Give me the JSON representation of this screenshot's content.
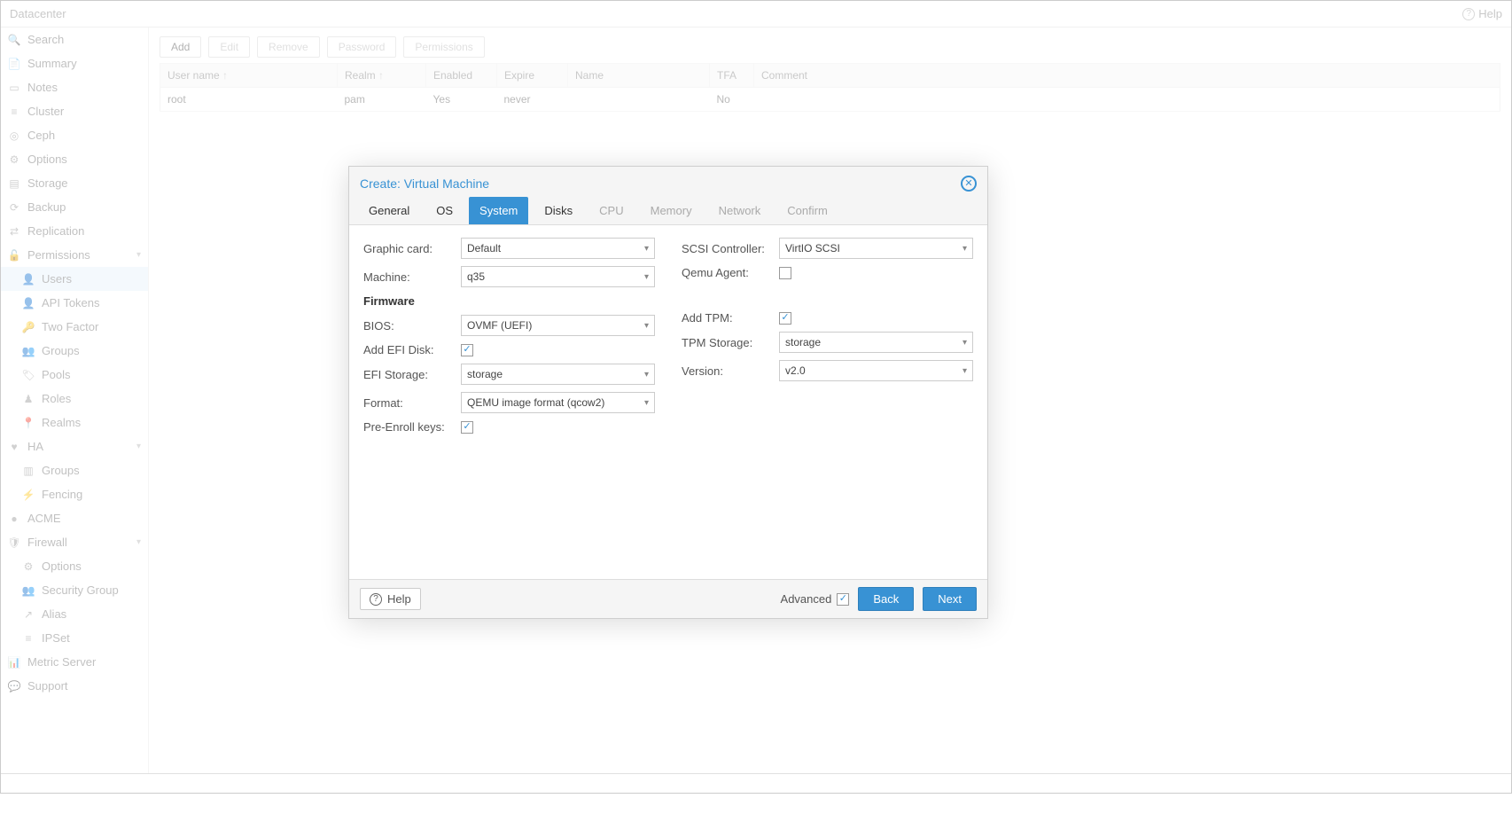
{
  "header": {
    "title": "Datacenter",
    "help": "Help"
  },
  "sidebar": {
    "items": [
      {
        "label": "Search",
        "icon": "🔍"
      },
      {
        "label": "Summary",
        "icon": "📄"
      },
      {
        "label": "Notes",
        "icon": "▭"
      },
      {
        "label": "Cluster",
        "icon": "≡"
      },
      {
        "label": "Ceph",
        "icon": "◎"
      },
      {
        "label": "Options",
        "icon": "⚙"
      },
      {
        "label": "Storage",
        "icon": "▤"
      },
      {
        "label": "Backup",
        "icon": "⟳"
      },
      {
        "label": "Replication",
        "icon": "⇄"
      },
      {
        "label": "Permissions",
        "icon": "🔓",
        "expandable": true
      },
      {
        "label": "Users",
        "icon": "👤",
        "child": true,
        "selected": true
      },
      {
        "label": "API Tokens",
        "icon": "👤",
        "child": true
      },
      {
        "label": "Two Factor",
        "icon": "🔑",
        "child": true
      },
      {
        "label": "Groups",
        "icon": "👥",
        "child": true
      },
      {
        "label": "Pools",
        "icon": "🏷",
        "child": true
      },
      {
        "label": "Roles",
        "icon": "♟",
        "child": true
      },
      {
        "label": "Realms",
        "icon": "📍",
        "child": true
      },
      {
        "label": "HA",
        "icon": "♥",
        "expandable": true
      },
      {
        "label": "Groups",
        "icon": "▥",
        "child": true
      },
      {
        "label": "Fencing",
        "icon": "⚡",
        "child": true
      },
      {
        "label": "ACME",
        "icon": "●"
      },
      {
        "label": "Firewall",
        "icon": "🛡",
        "expandable": true
      },
      {
        "label": "Options",
        "icon": "⚙",
        "child": true
      },
      {
        "label": "Security Group",
        "icon": "👥",
        "child": true
      },
      {
        "label": "Alias",
        "icon": "↗",
        "child": true
      },
      {
        "label": "IPSet",
        "icon": "≡",
        "child": true
      },
      {
        "label": "Metric Server",
        "icon": "📊"
      },
      {
        "label": "Support",
        "icon": "💬"
      }
    ]
  },
  "toolbar": {
    "buttons": [
      {
        "label": "Add",
        "enabled": true
      },
      {
        "label": "Edit",
        "enabled": false
      },
      {
        "label": "Remove",
        "enabled": false
      },
      {
        "label": "Password",
        "enabled": false
      },
      {
        "label": "Permissions",
        "enabled": false
      }
    ]
  },
  "table": {
    "columns": [
      "User name",
      "Realm",
      "Enabled",
      "Expire",
      "Name",
      "TFA",
      "Comment"
    ],
    "rows": [
      {
        "user": "root",
        "realm": "pam",
        "enabled": "Yes",
        "expire": "never",
        "name": "",
        "tfa": "No",
        "comment": ""
      }
    ]
  },
  "modal": {
    "title": "Create: Virtual Machine",
    "tabs": [
      {
        "label": "General",
        "state": "done"
      },
      {
        "label": "OS",
        "state": "done"
      },
      {
        "label": "System",
        "state": "active"
      },
      {
        "label": "Disks",
        "state": "done"
      },
      {
        "label": "CPU",
        "state": "disabled"
      },
      {
        "label": "Memory",
        "state": "disabled"
      },
      {
        "label": "Network",
        "state": "disabled"
      },
      {
        "label": "Confirm",
        "state": "disabled"
      }
    ],
    "left": {
      "graphic_label": "Graphic card:",
      "graphic_value": "Default",
      "machine_label": "Machine:",
      "machine_value": "q35",
      "firmware_heading": "Firmware",
      "bios_label": "BIOS:",
      "bios_value": "OVMF (UEFI)",
      "efi_disk_label": "Add EFI Disk:",
      "efi_disk_checked": true,
      "efi_storage_label": "EFI Storage:",
      "efi_storage_value": "storage",
      "format_label": "Format:",
      "format_value": "QEMU image format (qcow2)",
      "preenroll_label": "Pre-Enroll keys:",
      "preenroll_checked": true
    },
    "right": {
      "scsi_label": "SCSI Controller:",
      "scsi_value": "VirtIO SCSI",
      "qemu_label": "Qemu Agent:",
      "qemu_checked": false,
      "tpm_label": "Add TPM:",
      "tpm_checked": true,
      "tpm_storage_label": "TPM Storage:",
      "tpm_storage_value": "storage",
      "version_label": "Version:",
      "version_value": "v2.0"
    },
    "footer": {
      "help": "Help",
      "advanced": "Advanced",
      "advanced_checked": true,
      "back": "Back",
      "next": "Next"
    }
  }
}
